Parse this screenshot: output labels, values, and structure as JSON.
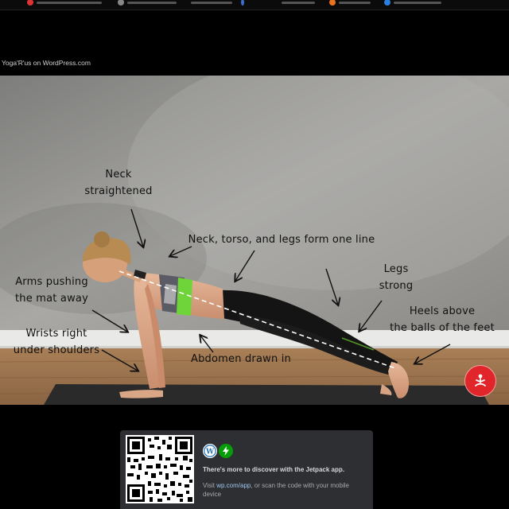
{
  "site": {
    "title": "Yoga'R'us on WordPress.com"
  },
  "annotations": [
    {
      "id": "neck",
      "text": "Neck\nstraightened"
    },
    {
      "id": "line",
      "text": "Neck, torso, and legs form one line"
    },
    {
      "id": "legs",
      "text": "Legs\nstrong"
    },
    {
      "id": "arms",
      "text": "Arms pushing\nthe mat away"
    },
    {
      "id": "heels",
      "text": "Heels above\nthe balls of the feet"
    },
    {
      "id": "wrists",
      "text": "Wrists right\nunder shoulders"
    },
    {
      "id": "abdomen",
      "text": "Abdomen drawn in"
    }
  ],
  "jetpack": {
    "headline": "There's more to discover with the Jetpack app.",
    "body_prefix": "Visit ",
    "link_text": "wp.com/app",
    "body_suffix": ", or scan the code with your mobile device"
  },
  "icons": {
    "yoga_button": "yoga-pose-icon",
    "wordpress": "wordpress-icon",
    "jetpack": "jetpack-bolt-icon"
  },
  "colors": {
    "yoga_button": "#e0262b",
    "jetpack_green": "#069e08",
    "wordpress_blue": "#2a75b5",
    "card_bg": "#2d2f33",
    "link": "#9fc7f0"
  }
}
